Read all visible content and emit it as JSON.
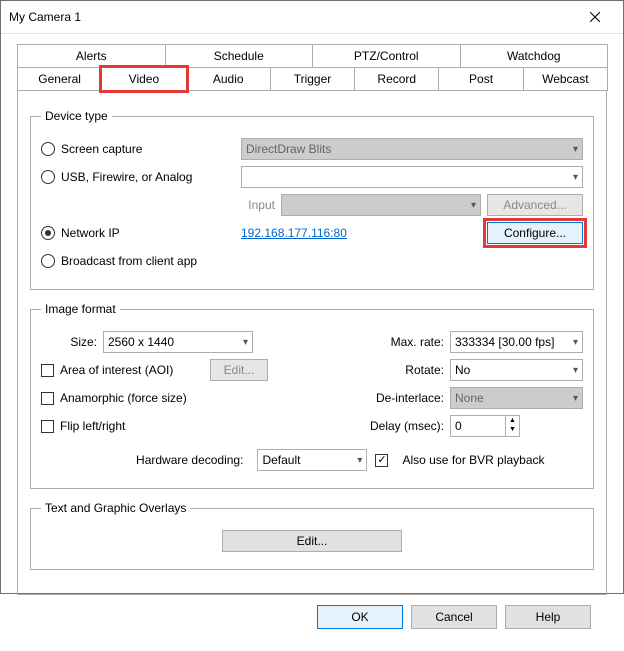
{
  "window": {
    "title": "My Camera 1"
  },
  "tabs": {
    "row1": [
      "Alerts",
      "Schedule",
      "PTZ/Control",
      "Watchdog"
    ],
    "row2": [
      "General",
      "Video",
      "Audio",
      "Trigger",
      "Record",
      "Post",
      "Webcast"
    ],
    "active": "Video",
    "highlighted": "Video"
  },
  "device_type": {
    "legend": "Device type",
    "screen_capture": {
      "label": "Screen capture",
      "dropdown": "DirectDraw Blits"
    },
    "usb": {
      "label": "USB, Firewire, or Analog",
      "value": ""
    },
    "input": {
      "label": "Input",
      "value": "",
      "advanced": "Advanced..."
    },
    "network_ip": {
      "label": "Network IP",
      "address": "192.168.177.116:80",
      "configure": "Configure..."
    },
    "broadcast": {
      "label": "Broadcast from client app"
    },
    "selected": "network_ip"
  },
  "image_format": {
    "legend": "Image format",
    "size": {
      "label": "Size:",
      "value": "2560 x 1440"
    },
    "aoi": {
      "label": "Area of interest (AOI)",
      "edit": "Edit..."
    },
    "anamorphic": {
      "label": "Anamorphic (force size)"
    },
    "flip": {
      "label": "Flip left/right"
    },
    "max_rate": {
      "label": "Max. rate:",
      "value": "333334 [30.00 fps]"
    },
    "rotate": {
      "label": "Rotate:",
      "value": "No"
    },
    "deinterlace": {
      "label": "De-interlace:",
      "value": "None"
    },
    "delay": {
      "label": "Delay (msec):",
      "value": "0"
    },
    "hw_decoding": {
      "label": "Hardware decoding:",
      "value": "Default"
    },
    "bvr": {
      "label": "Also use for BVR playback",
      "checked": true
    }
  },
  "overlays": {
    "legend": "Text and Graphic Overlays",
    "edit": "Edit..."
  },
  "buttons": {
    "ok": "OK",
    "cancel": "Cancel",
    "help": "Help"
  }
}
